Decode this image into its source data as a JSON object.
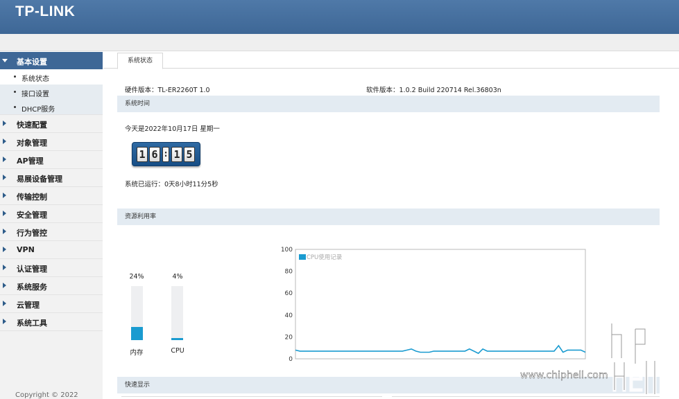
{
  "header": {
    "logo": "TP-LINK"
  },
  "sidebar": {
    "groups": [
      {
        "label": "基本设置",
        "active": true
      },
      {
        "label": "快速配置"
      },
      {
        "label": "对象管理"
      },
      {
        "label": "AP管理"
      },
      {
        "label": "易展设备管理"
      },
      {
        "label": "传输控制"
      },
      {
        "label": "安全管理"
      },
      {
        "label": "行为管控"
      },
      {
        "label": "VPN"
      },
      {
        "label": "认证管理"
      },
      {
        "label": "系统服务"
      },
      {
        "label": "云管理"
      },
      {
        "label": "系统工具"
      }
    ],
    "sub_items": [
      {
        "label": "系统状态",
        "selected": true
      },
      {
        "label": "接口设置"
      },
      {
        "label": "DHCP服务"
      }
    ],
    "copyright": "Copyright © 2022"
  },
  "main": {
    "tab": "系统状态",
    "hardware": "硬件版本：TL-ER2260T 1.0",
    "software": "软件版本：1.0.2 Build 220714 Rel.36803n",
    "section_time": "系统时间",
    "today": "今天是2022年10月17日 星期一",
    "clock": {
      "h1": "1",
      "h2": "6",
      "sep": ":",
      "m1": "1",
      "m2": "5"
    },
    "uptime": "系统已运行：0天8小时11分5秒",
    "section_resources": "资源利用率",
    "memory": {
      "percent_text": "24%",
      "label": "内存",
      "value": 24
    },
    "cpu": {
      "percent_text": "4%",
      "label": "CPU",
      "value": 4
    },
    "section_quick": "快速显示"
  },
  "chart_data": {
    "type": "line",
    "legend": "CPU使用记录",
    "ylim": [
      0,
      100
    ],
    "yticks": [
      "0",
      "20",
      "40",
      "60",
      "80",
      "100"
    ],
    "series": [
      {
        "name": "CPU使用记录",
        "color": "#1a9bd0",
        "values": [
          8,
          7,
          7,
          7,
          7,
          7,
          7,
          7,
          7,
          7,
          7,
          7,
          7,
          7,
          7,
          7,
          7,
          7,
          7,
          7,
          7,
          7,
          7,
          7,
          7,
          8,
          9,
          7,
          6,
          6,
          6,
          7,
          7,
          7,
          7,
          7,
          7,
          7,
          7,
          9,
          7,
          5,
          9,
          7,
          7,
          7,
          7,
          7,
          7,
          7,
          7,
          7,
          7,
          7,
          7,
          7,
          7,
          7,
          7,
          12,
          6,
          8,
          8,
          8,
          8,
          6
        ]
      }
    ],
    "grid": false,
    "legend_position": "top-left"
  },
  "watermark": {
    "text": "www.chiphell.com"
  }
}
